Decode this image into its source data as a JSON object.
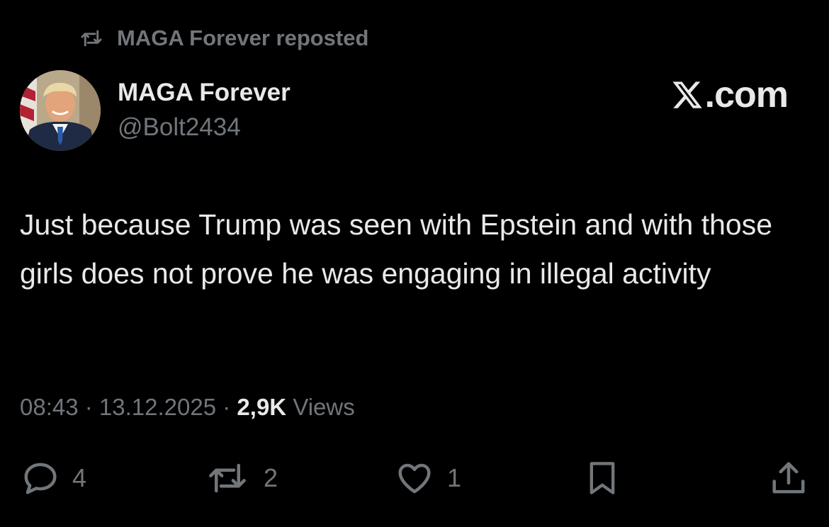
{
  "repost_banner": {
    "icon": "repost-icon",
    "text": "MAGA Forever reposted"
  },
  "author": {
    "avatar": "avatar-photo",
    "display_name": "MAGA Forever",
    "handle": "@Bolt2434"
  },
  "watermark": {
    "icon": "x-logo-icon",
    "text": ".com"
  },
  "tweet": {
    "text": "Just because Trump was seen with Epstein and with those girls does not prove he was engaging in illegal activity"
  },
  "meta": {
    "time": "08:43",
    "separator": " · ",
    "date": "13.12.2025",
    "views_count": "2,9K",
    "views_label": "Views"
  },
  "actions": {
    "reply": {
      "icon": "reply-icon",
      "count": "4"
    },
    "repost": {
      "icon": "repost-icon",
      "count": "2"
    },
    "like": {
      "icon": "heart-icon",
      "count": "1"
    },
    "bookmark": {
      "icon": "bookmark-icon"
    },
    "share": {
      "icon": "share-icon"
    }
  },
  "colors": {
    "background": "#000000",
    "primary_text": "#e7e9ea",
    "secondary_text": "#71767b"
  }
}
